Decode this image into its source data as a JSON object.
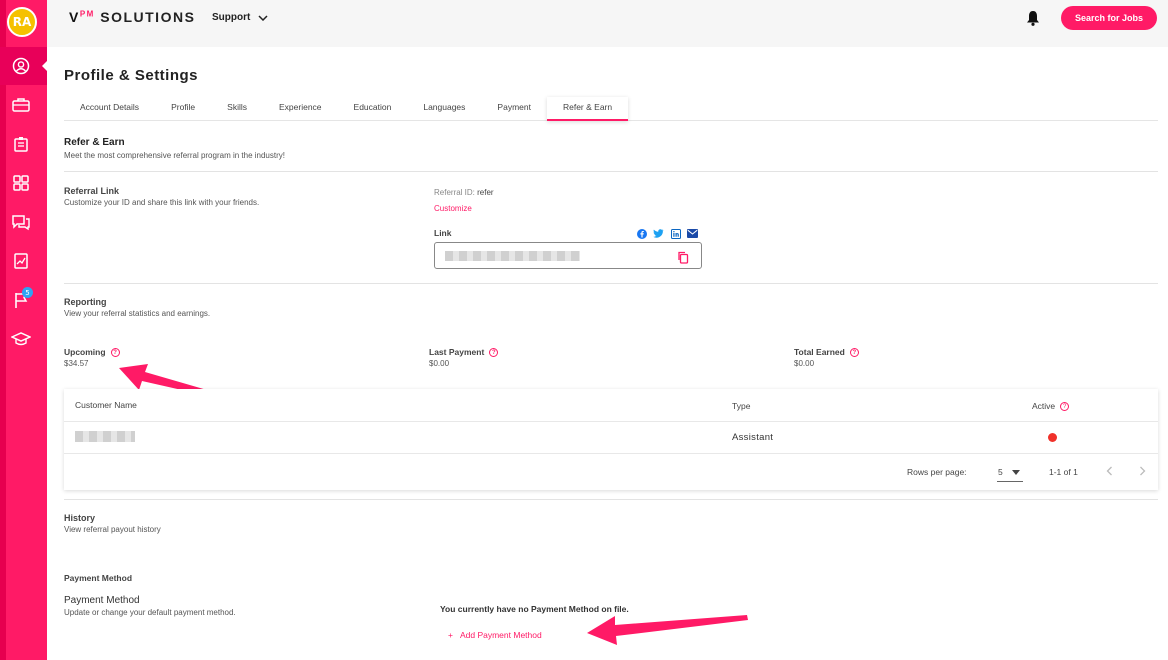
{
  "user": {
    "initials": "RA"
  },
  "header": {
    "logo_v": "V",
    "logo_pm": "PM",
    "logo_rest": " SOLUTIONS",
    "support_label": "Support",
    "search_button": "Search for Jobs"
  },
  "sidebar": {
    "items": [
      {
        "icon": "profile-icon"
      },
      {
        "icon": "briefcase-icon"
      },
      {
        "icon": "clipboard-icon"
      },
      {
        "icon": "apps-grid-icon"
      },
      {
        "icon": "chat-icon"
      },
      {
        "icon": "report-icon"
      },
      {
        "icon": "flag-icon",
        "badge": "5"
      },
      {
        "icon": "graduation-icon"
      }
    ]
  },
  "page": {
    "title": "Profile & Settings",
    "tabs": [
      "Account Details",
      "Profile",
      "Skills",
      "Experience",
      "Education",
      "Languages",
      "Payment",
      "Refer & Earn"
    ],
    "active_tab": "Refer & Earn"
  },
  "refer": {
    "title": "Refer & Earn",
    "subtitle": "Meet the most comprehensive referral program in the industry!",
    "referral_link_title": "Referral Link",
    "referral_link_desc": "Customize your ID and share this link with your friends.",
    "referral_id_label": "Referral ID:",
    "referral_id_value": "refer",
    "customize": "Customize",
    "link_label": "Link"
  },
  "reporting": {
    "title": "Reporting",
    "desc": "View your referral statistics and earnings.",
    "stats": [
      {
        "label": "Upcoming",
        "value": "$34.57"
      },
      {
        "label": "Last Payment",
        "value": "$0.00"
      },
      {
        "label": "Total Earned",
        "value": "$0.00"
      }
    ]
  },
  "table": {
    "columns": [
      "Customer Name",
      "Type",
      "Active"
    ],
    "rows": [
      {
        "type": "Assistant",
        "active_color": "#f0312a"
      }
    ],
    "rows_per_page_label": "Rows per page:",
    "rows_per_page": "5",
    "range": "1-1 of 1"
  },
  "history": {
    "title": "History",
    "desc": "View referral payout history"
  },
  "payment": {
    "section_label": "Payment Method",
    "title": "Payment Method",
    "desc": "Update or change your default payment method.",
    "none_on_file": "You currently have no Payment Method on file.",
    "add_label": "Add Payment Method"
  },
  "colors": {
    "brand": "#ff1a66",
    "avatar": "#f5c100"
  }
}
